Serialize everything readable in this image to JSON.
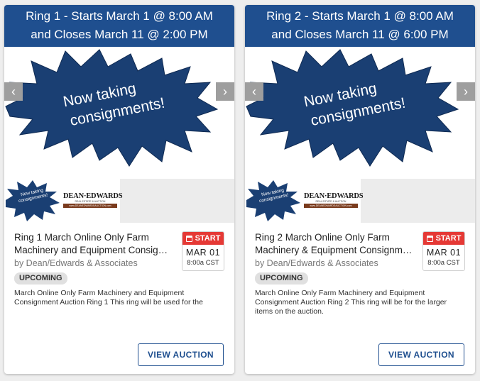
{
  "cards": [
    {
      "header_line1": "Ring 1 - Starts March 1 @ 8:00 AM",
      "header_line2": "and Closes March 11 @ 2:00 PM",
      "banner_line1": "Now taking",
      "banner_line2": "consignments!",
      "thumb_banner": "Now taking consignments!",
      "logo_name": "DEAN·EDWARDS",
      "logo_tag": "REAL ESTATE & AUCTION",
      "logo_url": "www.DEANEDWARDSAUCTION.com",
      "title_line1": "Ring 1 March Online Only Farm",
      "title_line2": "Machinery and Equipment Consignment Auction",
      "byline": "by Dean/Edwards & Associates",
      "status": "UPCOMING",
      "start_label": "START",
      "date": "MAR 01",
      "time": "8:00a CST",
      "description": "March Online Only Farm Machinery and Equipment Consignment Auction Ring 1 This ring will be used for the",
      "button_label": "VIEW AUCTION"
    },
    {
      "header_line1": "Ring 2 - Starts March 1 @ 8:00 AM",
      "header_line2": "and Closes March 11 @ 6:00 PM",
      "banner_line1": "Now taking",
      "banner_line2": "consignments!",
      "thumb_banner": "Now taking consignments!",
      "logo_name": "DEAN·EDWARDS",
      "logo_tag": "REAL ESTATE & AUCTION",
      "logo_url": "www.DEANEDWARDSAUCTION.com",
      "title_line1": "Ring 2 March Online Only Farm",
      "title_line2": "Machinery & Equipment Consignment Auction",
      "byline": "by Dean/Edwards & Associates",
      "status": "UPCOMING",
      "start_label": "START",
      "date": "MAR 01",
      "time": "8:00a CST",
      "description": "March Online Only Farm Machinery and Equipment Consignment Auction Ring 2 This ring will be for the larger items on the auction.",
      "button_label": "VIEW AUCTION"
    }
  ],
  "icons": {
    "prev": "chevron-left-icon",
    "next": "chevron-right-icon",
    "calendar": "calendar-icon"
  },
  "colors": {
    "header_bg": "#1f4f8f",
    "burst_fill": "#1a3f73",
    "start_bg": "#e53935",
    "button_text": "#1f4f8f"
  }
}
